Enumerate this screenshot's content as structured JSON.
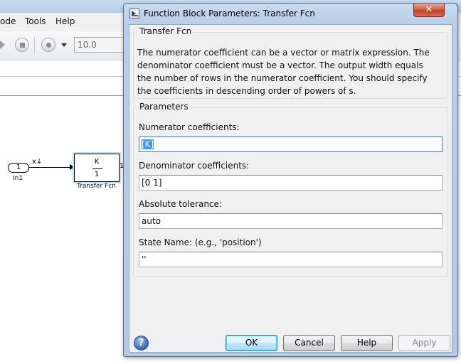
{
  "background": {
    "menu": [
      "ode",
      "Tools",
      "Help"
    ],
    "stop_time": "10.0",
    "model": {
      "inport_number": "1",
      "inport_name": "In1",
      "signal_label": "x↓",
      "block_numerator": "K",
      "block_denominator": "1",
      "block_name": "Transfer Fcn",
      "out_stub": "1"
    }
  },
  "dialog": {
    "title": "Function Block Parameters: Transfer Fcn",
    "close_glyph": "✕",
    "block_section_title": "Transfer Fcn",
    "description": "The numerator coefficient can be a vector or matrix expression. The denominator coefficient must be a vector. The output width equals the number of rows in the numerator coefficient. You should specify the coefficients in descending order of powers of s.",
    "parameters_title": "Parameters",
    "fields": {
      "numerator": {
        "label": "Numerator coefficients:",
        "value": "[K]"
      },
      "denominator": {
        "label": "Denominator coefficients:",
        "value": "[0 1]"
      },
      "tolerance": {
        "label": "Absolute tolerance:",
        "value": "auto"
      },
      "state_name": {
        "label": "State Name: (e.g., 'position')",
        "value": "''"
      }
    },
    "help_glyph": "?",
    "buttons": {
      "ok": "OK",
      "cancel": "Cancel",
      "help": "Help",
      "apply": "Apply"
    }
  }
}
